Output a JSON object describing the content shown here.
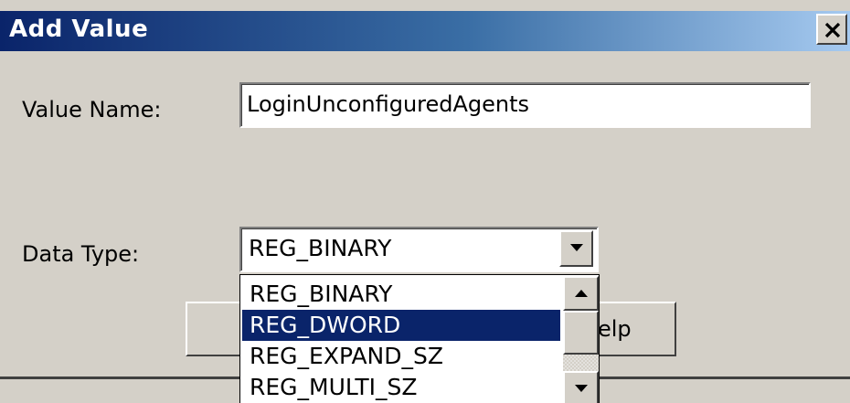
{
  "window": {
    "title": "Add Value",
    "close_icon": "close-x-icon"
  },
  "form": {
    "value_name_label": "Value Name:",
    "value_name_value": "LoginUnconfiguredAgents",
    "data_type_label": "Data Type:",
    "data_type_selected": "REG_BINARY",
    "dropdown_icon": "chevron-down-icon"
  },
  "buttons": {
    "help_label_visible": "elp"
  },
  "dropdown_list": {
    "items": [
      {
        "label": "REG_BINARY",
        "selected": false
      },
      {
        "label": "REG_DWORD",
        "selected": true
      },
      {
        "label": "REG_EXPAND_SZ",
        "selected": false
      },
      {
        "label": "REG_MULTI_SZ",
        "selected": false
      }
    ],
    "scroll_up_icon": "scroll-up-arrow-icon",
    "scroll_down_icon": "scroll-down-arrow-icon"
  },
  "colors": {
    "face": "#d4d0c8",
    "title_start": "#0a246a",
    "title_end": "#a6caf0",
    "selection": "#0a246a"
  }
}
